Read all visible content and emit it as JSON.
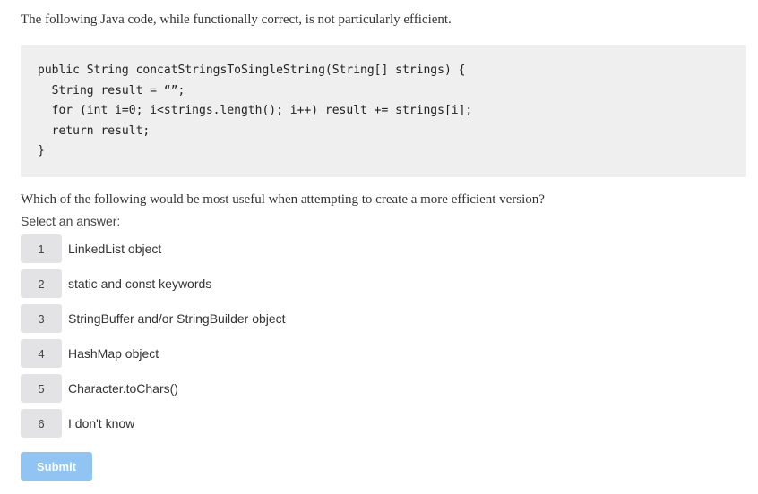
{
  "intro": "The following Java code, while functionally correct, is not particularly efficient.",
  "code": "public String concatStringsToSingleString(String[] strings) {\n  String result = “”;\n  for (int i=0; i<strings.length(); i++) result += strings[i];\n  return result;\n}",
  "question": "Which of the following would be most useful when attempting to create a more efficient version?",
  "select_label": "Select an answer:",
  "options": [
    {
      "num": "1",
      "label": "LinkedList object"
    },
    {
      "num": "2",
      "label": "static and const keywords"
    },
    {
      "num": "3",
      "label": "StringBuffer and/or StringBuilder object"
    },
    {
      "num": "4",
      "label": "HashMap object"
    },
    {
      "num": "5",
      "label": "Character.toChars()"
    },
    {
      "num": "6",
      "label": "I don't know"
    }
  ],
  "submit_label": "Submit",
  "colors": {
    "code_bg": "#efeff0",
    "option_bg": "#e3e3e6",
    "submit_bg": "#90c4f2"
  }
}
